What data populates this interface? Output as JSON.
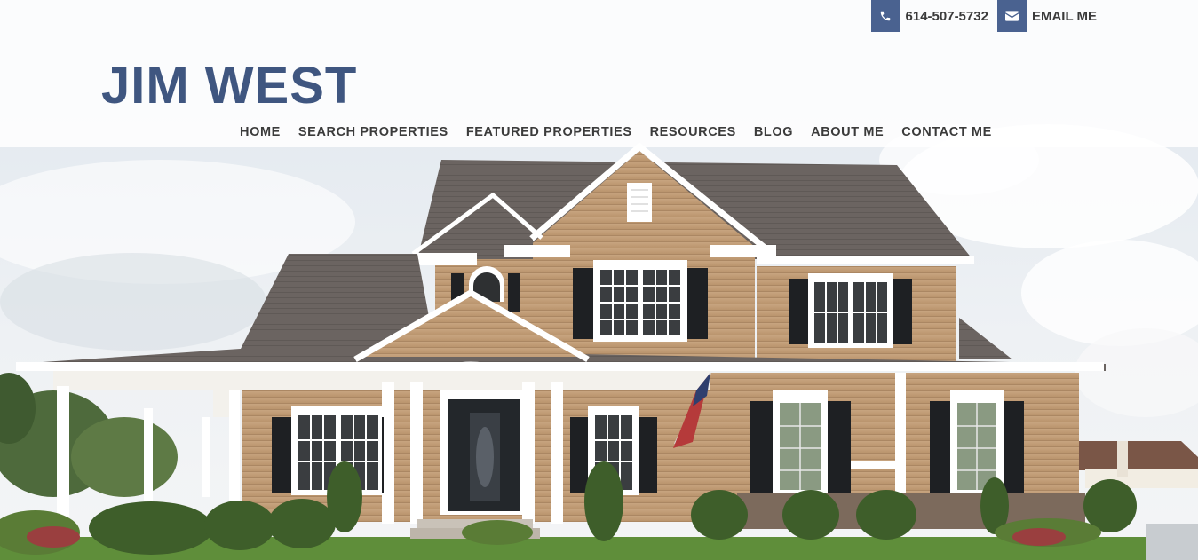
{
  "brand": {
    "logo_text": "JIM WEST",
    "accent_color": "#4a6290",
    "logo_color": "#3f5680"
  },
  "contact": {
    "phone": {
      "icon": "phone-icon",
      "label": "614-507-5732"
    },
    "email": {
      "icon": "envelope-icon",
      "label": "EMAIL ME"
    }
  },
  "nav": {
    "items": [
      {
        "label": "HOME"
      },
      {
        "label": "SEARCH PROPERTIES"
      },
      {
        "label": "FEATURED PROPERTIES"
      },
      {
        "label": "RESOURCES"
      },
      {
        "label": "BLOG"
      },
      {
        "label": "ABOUT ME"
      },
      {
        "label": "CONTACT ME"
      }
    ]
  },
  "hero": {
    "image": "house-photo"
  }
}
